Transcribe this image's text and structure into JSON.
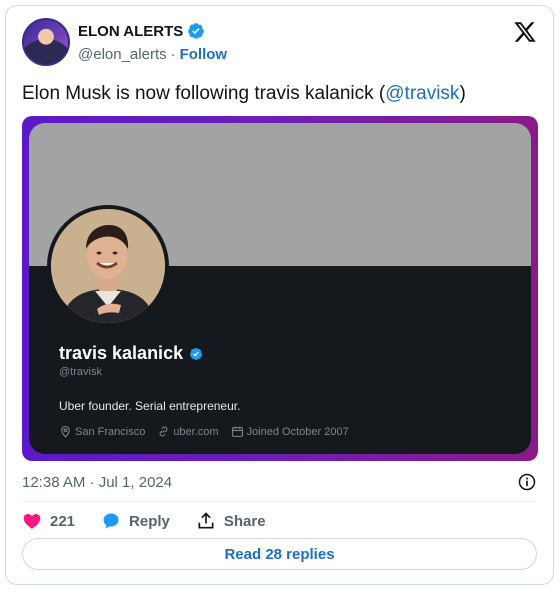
{
  "author": {
    "name": "ELON ALERTS",
    "handle": "@elon_alerts",
    "separator": "·",
    "follow_label": "Follow"
  },
  "tweet": {
    "text_before": "Elon Musk is now following travis kalanick (",
    "mention": "@travisk",
    "text_after": ")"
  },
  "embedded_profile": {
    "name": "travis kalanick",
    "handle": "@travisk",
    "bio": "Uber founder. Serial entrepreneur.",
    "location": "San Francisco",
    "website": "uber.com",
    "joined": "Joined October 2007"
  },
  "meta": {
    "timestamp": "12:38 AM · Jul 1, 2024"
  },
  "actions": {
    "like_count": "221",
    "reply_label": "Reply",
    "share_label": "Share"
  },
  "read_replies_label": "Read 28 replies",
  "colors": {
    "verified": "#1d9bf0",
    "link": "#1d6fbf",
    "heart": "#f91880"
  }
}
